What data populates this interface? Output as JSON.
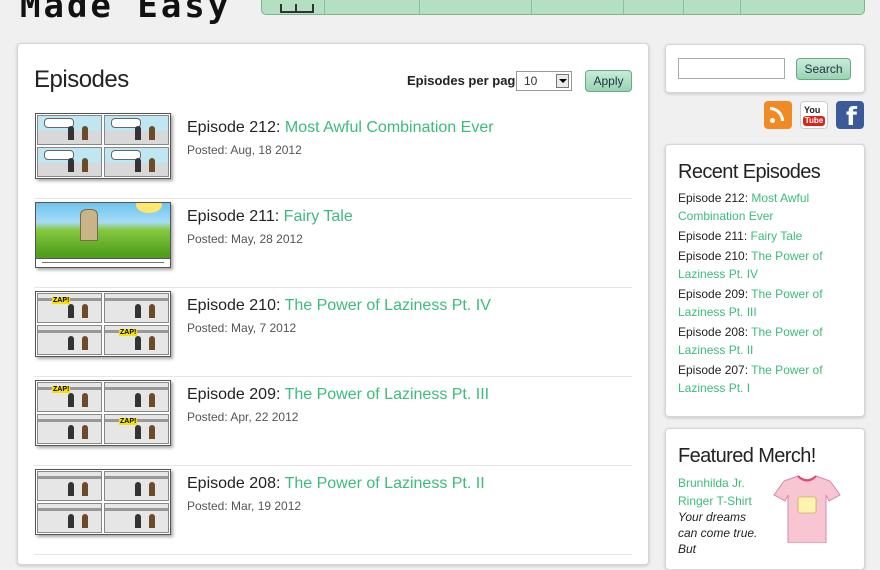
{
  "site": {
    "logo_text": "Made Easy"
  },
  "topnav": {
    "segments": 8
  },
  "main": {
    "title": "Episodes",
    "per_page_label": "Episodes per page",
    "per_page_value": "10",
    "apply_label": "Apply"
  },
  "episodes": [
    {
      "prefix": "Episode 212: ",
      "title": "Most Awful Combination Ever",
      "date": "Posted: Aug, 18 2012",
      "thumb": "comic"
    },
    {
      "prefix": "Episode 211: ",
      "title": "Fairy Tale",
      "date": "Posted: May, 28 2012",
      "thumb": "fairy"
    },
    {
      "prefix": "Episode 210: ",
      "title": "The Power of Laziness Pt. IV",
      "date": "Posted: May, 7 2012",
      "thumb": "zap"
    },
    {
      "prefix": "Episode 209: ",
      "title": "The Power of Laziness Pt. III",
      "date": "Posted: Apr, 22 2012",
      "thumb": "zap"
    },
    {
      "prefix": "Episode 208: ",
      "title": "The Power of Laziness Pt. II",
      "date": "Posted: Mar, 19 2012",
      "thumb": "office"
    }
  ],
  "sidebar": {
    "search_button": "Search",
    "social_icons": [
      "rss-icon",
      "youtube-icon",
      "facebook-icon"
    ],
    "youtube_text_top": "You",
    "youtube_text_bottom": "Tube",
    "facebook_letter": "f",
    "recent_title": "Recent Episodes",
    "recent": [
      {
        "prefix": "Episode 212: ",
        "title": "Most Awful Combination Ever"
      },
      {
        "prefix": "Episode 211: ",
        "title": "Fairy Tale"
      },
      {
        "prefix": "Episode 210: ",
        "title": "The Power of Laziness Pt. IV"
      },
      {
        "prefix": "Episode 209: ",
        "title": "The Power of Laziness Pt. III"
      },
      {
        "prefix": "Episode 208: ",
        "title": "The Power of Laziness Pt. II"
      },
      {
        "prefix": "Episode 207: ",
        "title": "The Power of Laziness Pt. I"
      }
    ],
    "merch_title": "Featured Merch!",
    "merch_name": "Brunhilda Jr. Ringer T-Shirt",
    "merch_desc": "Your dreams can come true. But"
  },
  "colors": {
    "link": "#3cbc7c",
    "nav": "#b4dfc2",
    "button": "#98d4b2"
  }
}
